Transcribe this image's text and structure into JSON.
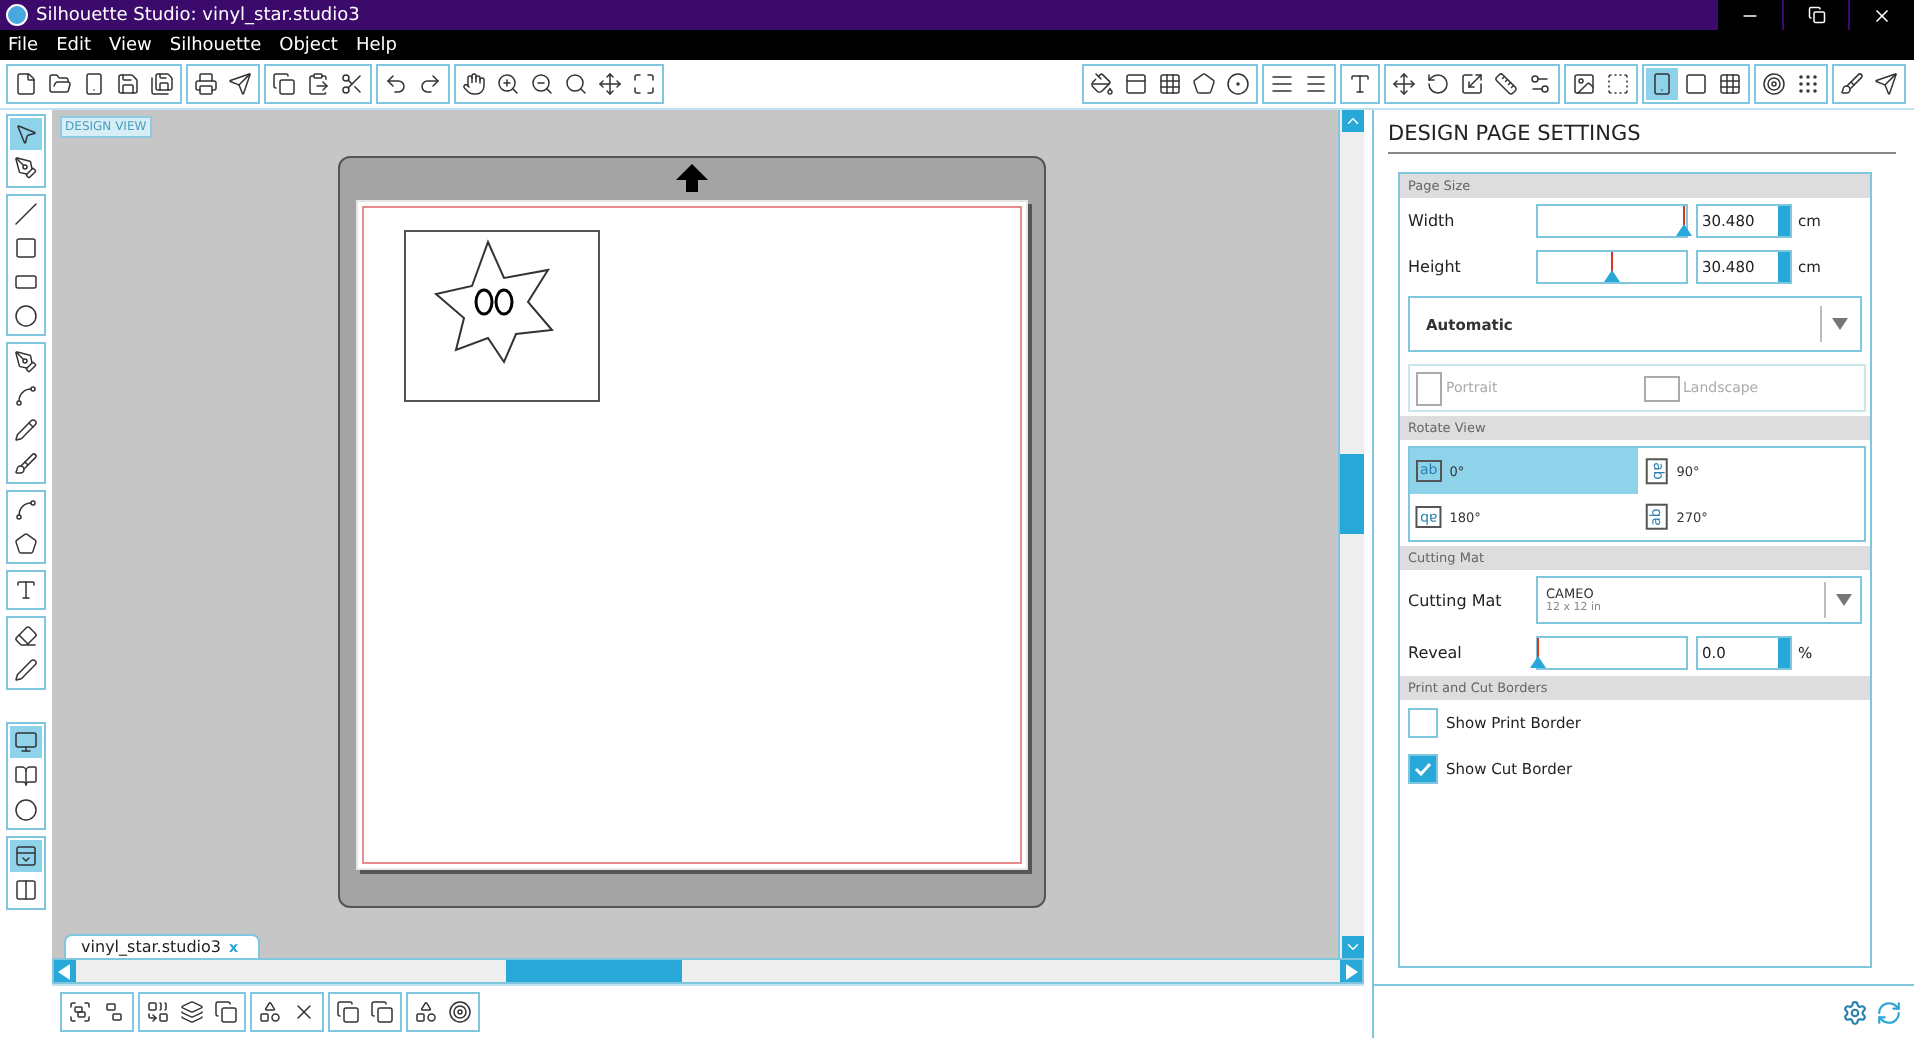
{
  "window": {
    "title": "Silhouette Studio: vinyl_star.studio3"
  },
  "menu": [
    "File",
    "Edit",
    "View",
    "Silhouette",
    "Object",
    "Help"
  ],
  "canvas": {
    "view_label": "DESIGN VIEW",
    "document_tab": "vinyl_star.studio3",
    "tab_close": "x"
  },
  "panel": {
    "title": "DESIGN PAGE SETTINGS",
    "page_size": {
      "heading": "Page Size",
      "fields": [
        {
          "label": "Width",
          "level": 0.98,
          "value": "30.480",
          "unit": "cm"
        },
        {
          "label": "Height",
          "level": 0.5,
          "value": "30.480",
          "unit": "cm"
        }
      ],
      "preset": "Automatic",
      "orientations": [
        {
          "label": "Portrait",
          "disabled": true
        },
        {
          "label": "Landscape",
          "disabled": true
        }
      ]
    },
    "rotate_view": {
      "heading": "Rotate View",
      "options": [
        {
          "label": "0°",
          "glyph": "ab",
          "kind": "upright",
          "selected": true
        },
        {
          "label": "90°",
          "glyph": "ab",
          "kind": "right",
          "selected": false
        },
        {
          "label": "180°",
          "glyph": "ab",
          "kind": "inverted",
          "selected": false
        },
        {
          "label": "270°",
          "glyph": "ab",
          "kind": "left",
          "selected": false
        }
      ]
    },
    "cutting_mat": {
      "heading": "Cutting Mat",
      "label": "Cutting Mat",
      "mat": "CAMEO",
      "mat_size": "12 x 12 in",
      "reveal": {
        "label": "Reveal",
        "level": 0,
        "value": "0.0",
        "unit": "%"
      }
    },
    "borders": {
      "heading": "Print and Cut Borders",
      "options": [
        {
          "label": "Show Print Border",
          "checked": false
        },
        {
          "label": "Show Cut Border",
          "checked": true
        }
      ]
    }
  }
}
